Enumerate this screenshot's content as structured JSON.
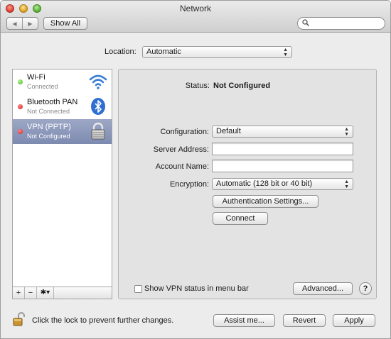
{
  "window": {
    "title": "Network"
  },
  "toolbar": {
    "back_label": "◀",
    "forward_label": "▶",
    "show_all_label": "Show All",
    "search_placeholder": ""
  },
  "location": {
    "label": "Location:",
    "value": "Automatic"
  },
  "services": [
    {
      "name": "Wi-Fi",
      "status": "Connected",
      "indicator": "green",
      "icon": "wifi-icon",
      "selected": false
    },
    {
      "name": "Bluetooth PAN",
      "status": "Not Connected",
      "indicator": "red",
      "icon": "bluetooth-icon",
      "selected": false
    },
    {
      "name": "VPN (PPTP)",
      "status": "Not Configured",
      "indicator": "red",
      "icon": "vpn-lock-icon",
      "selected": true
    }
  ],
  "sidebar_toolbar": {
    "add": "+",
    "remove": "−",
    "action": "✱▾"
  },
  "detail": {
    "status_label": "Status:",
    "status_value": "Not Configured",
    "configuration_label": "Configuration:",
    "configuration_value": "Default",
    "server_address_label": "Server Address:",
    "server_address_value": "",
    "account_name_label": "Account Name:",
    "account_name_value": "",
    "encryption_label": "Encryption:",
    "encryption_value": "Automatic (128 bit or 40 bit)",
    "auth_settings_label": "Authentication Settings...",
    "connect_label": "Connect",
    "show_vpn_status_label": "Show VPN status in menu bar",
    "advanced_label": "Advanced...",
    "help_label": "?"
  },
  "footer": {
    "lock_text": "Click the lock to prevent further changes.",
    "assist_label": "Assist me...",
    "revert_label": "Revert",
    "apply_label": "Apply"
  },
  "colors": {
    "selection": "#8490b8",
    "connected": "#3fb21b",
    "disconnected": "#d41616"
  }
}
